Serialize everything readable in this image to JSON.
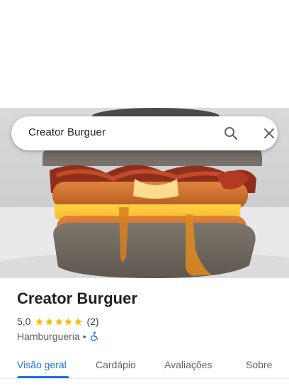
{
  "search": {
    "query": "Creator Burguer"
  },
  "place": {
    "name": "Creator Burguer",
    "rating": "5,0",
    "stars": 5,
    "review_count": "(2)",
    "category": "Hamburgueria",
    "separator": "•"
  },
  "tabs": [
    {
      "label": "Visão geral",
      "active": true
    },
    {
      "label": "Cardápio",
      "active": false
    },
    {
      "label": "Avaliações",
      "active": false
    },
    {
      "label": "Sobre",
      "active": false
    }
  ],
  "colors": {
    "accent": "#1a73e8",
    "star": "#fbbc04",
    "text": "#202124",
    "muted": "#5f6368"
  },
  "icons": {
    "search": "search-icon",
    "close": "close-icon",
    "star": "star-icon",
    "accessibility": "wheelchair-icon"
  }
}
